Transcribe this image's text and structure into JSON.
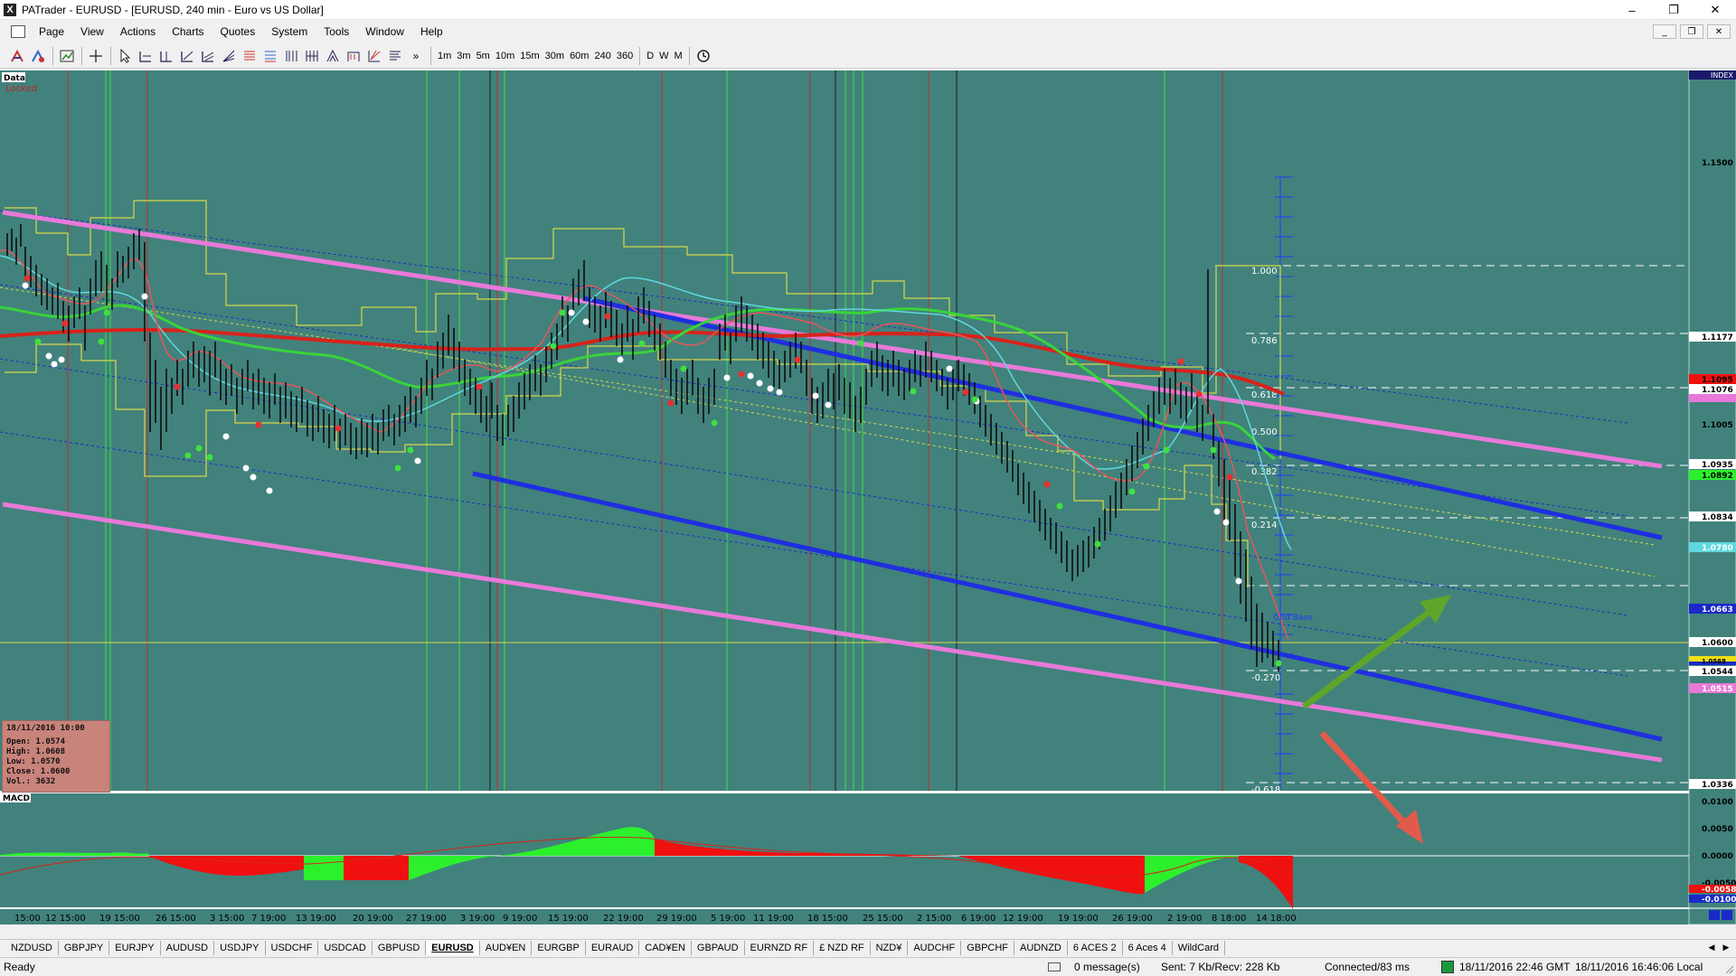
{
  "window": {
    "title": "PATrader - EURUSD - [EURUSD, 240 min - Euro vs US Dollar]",
    "controls": [
      "–",
      "❐",
      "✕"
    ]
  },
  "menu": {
    "items": [
      "Page",
      "View",
      "Actions",
      "Charts",
      "Quotes",
      "System",
      "Tools",
      "Window",
      "Help"
    ],
    "mdi_controls": [
      "_",
      "❐",
      "✕"
    ]
  },
  "toolbar": {
    "timeframes": [
      "1m",
      "3m",
      "5m",
      "10m",
      "15m",
      "30m",
      "60m",
      "240",
      "360"
    ],
    "periods": [
      "D",
      "W",
      "M"
    ],
    "more": "»"
  },
  "chart": {
    "labels": {
      "data": "Data",
      "locked": "Locked",
      "index": "INDEX",
      "macd": "MACD",
      "grid_base": "Grid Base"
    },
    "price_labels": [
      "1.1500",
      "1.1177",
      "1.1095",
      "1.1076",
      "1.1005",
      "1.0935",
      "1.0892",
      "1.0834",
      "1.0780",
      "1.0663",
      "1.0600",
      "1.0568",
      "1.0544",
      "1.0515",
      "1.0336"
    ],
    "fib_levels": [
      "1.000",
      "0.786",
      "0.618",
      "0.500",
      "0.382",
      "0.214",
      "-0.270",
      "-0.618"
    ],
    "macd_axis": [
      "0.0100",
      "0.0050",
      "0.0000",
      "-0.0050",
      "-0.0058",
      "-0.0100"
    ],
    "date_labels": [
      "15:00",
      "12 15:00",
      "19 15:00",
      "26 15:00",
      "3 15:00",
      "7 19:00",
      "13 19:00",
      "20 19:00",
      "27 19:00",
      "3 19:00",
      "9 19:00",
      "15 19:00",
      "22 19:00",
      "29 19:00",
      "5 19:00",
      "11 19:00",
      "18 15:00",
      "25 15:00",
      "2 15:00",
      "6 19:00",
      "12 19:00",
      "19 19:00",
      "26 19:00",
      "2 19:00",
      "8 18:00",
      "14 18:00"
    ],
    "bar_info": {
      "date": "18/11/2016 10:00",
      "open": "Open: 1.0574",
      "high": "High: 1.0608",
      "low": "Low: 1.0570",
      "close": "Close: 1.0600",
      "vol": "Vol.: 3632"
    }
  },
  "sheet_tabs": [
    "NZDUSD",
    "GBPJPY",
    "EURJPY",
    "AUDUSD",
    "USDJPY",
    "USDCHF",
    "USDCAD",
    "GBPUSD",
    "EURUSD",
    "AUD¥EN",
    "EURGBP",
    "EURAUD",
    "CAD¥EN",
    "GBPAUD",
    "EURNZD RF",
    "£ NZD RF",
    "NZD¥",
    "AUDCHF",
    "GBPCHF",
    "AUDNZD",
    "6 ACES 2",
    "6 Aces 4",
    "WildCard"
  ],
  "active_tab": "EURUSD",
  "status": {
    "ready": "Ready",
    "messages": "0 message(s)",
    "traffic": "Sent: 7 Kb/Recv: 228 Kb",
    "connection": "Connected/83 ms",
    "gmt_time": "18/11/2016 22:46 GMT",
    "local_time": "18/11/2016 16:46:06 Local"
  },
  "colors": {
    "chart_bg": "#41827c",
    "pink_channel": "#e879d9",
    "blue_channel": "#1f2fe0",
    "ma_red": "#d8221a",
    "ma_green": "#39d33a",
    "ma_cyan": "#5fd8df",
    "yellow": "#d8d84a",
    "macd_pos": "#2cf02c",
    "macd_neg": "#f01010",
    "arrow_green": "#5ea52a",
    "arrow_red": "#e25a4c"
  }
}
